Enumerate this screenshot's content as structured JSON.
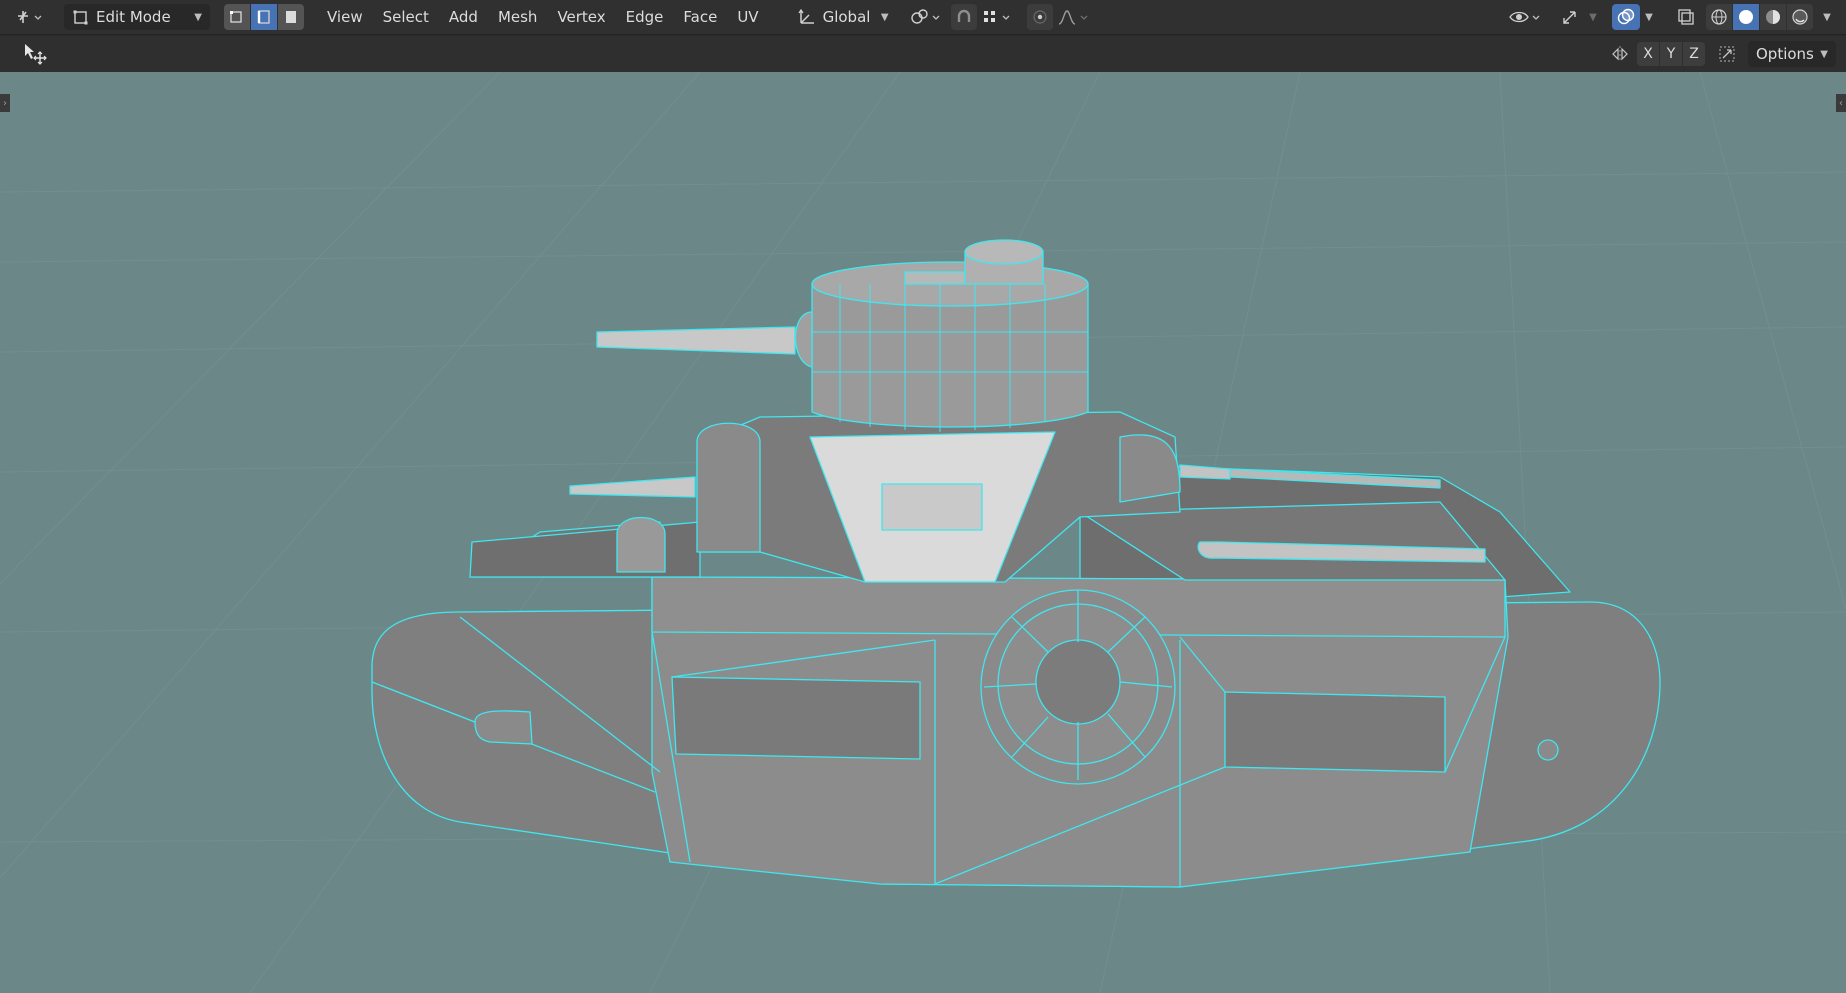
{
  "header": {
    "editor_type_icon": "viewport-3d-icon",
    "mode": {
      "icon": "edit-mode-icon",
      "label": "Edit Mode"
    },
    "select_modes": [
      {
        "name": "vertex-select-icon",
        "active": false
      },
      {
        "name": "edge-select-icon",
        "active": true
      },
      {
        "name": "face-select-icon",
        "active": false
      }
    ],
    "menus": [
      "View",
      "Select",
      "Add",
      "Mesh",
      "Vertex",
      "Edge",
      "Face",
      "UV"
    ],
    "orientation": {
      "icon": "transform-orientation-icon",
      "label": "Global"
    },
    "right_icons": [
      "visibility-icon",
      "gizmo-icon",
      "overlay-icon",
      "xray-icon"
    ],
    "shading_modes": [
      {
        "name": "wireframe-shading-icon",
        "active": false
      },
      {
        "name": "solid-shading-icon",
        "active": true
      },
      {
        "name": "material-shading-icon",
        "active": false
      },
      {
        "name": "rendered-shading-icon",
        "active": false
      }
    ]
  },
  "tool_header": {
    "tool_icon": "move-tool-icon",
    "axes": [
      "X",
      "Y",
      "Z"
    ],
    "options_label": "Options"
  },
  "colors": {
    "viewport_bg": "#6e8a8a",
    "grid_line": "#7d9797",
    "mesh_fill": "#8a8a8a",
    "edge_highlight": "#3fe7f0",
    "active_button": "#4772b3"
  }
}
